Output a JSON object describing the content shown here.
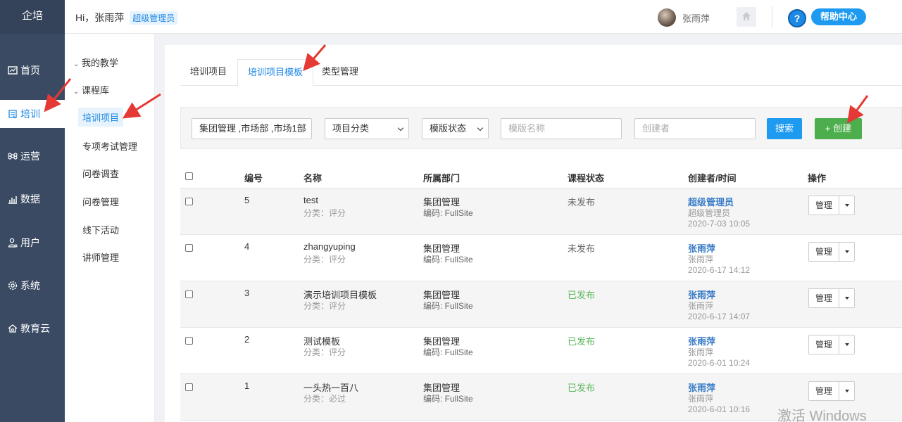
{
  "app": {
    "brand": "企培"
  },
  "leftnav": [
    {
      "label": "首页",
      "icon": "dashboard-icon",
      "active": false
    },
    {
      "label": "培训",
      "icon": "book-icon",
      "active": true
    },
    {
      "label": "运营",
      "icon": "command-icon",
      "active": false
    },
    {
      "label": "数据",
      "icon": "chart-icon",
      "active": false
    },
    {
      "label": "用户",
      "icon": "user-icon",
      "active": false
    },
    {
      "label": "系统",
      "icon": "gear-icon",
      "active": false
    },
    {
      "label": "教育云",
      "icon": "cloud-icon",
      "active": false
    }
  ],
  "header": {
    "greeting": "Hi，张雨萍",
    "role": "超级管理员",
    "username": "张雨萍",
    "help_label": "帮助中心",
    "help_q": "?"
  },
  "subnav": {
    "groups": [
      "我的教学",
      "课程库"
    ],
    "items": [
      "培训项目",
      "专项考试管理",
      "问卷调查",
      "问卷管理",
      "线下活动",
      "讲师管理"
    ]
  },
  "tabs": [
    "培训项目",
    "培训项目模板",
    "类型管理"
  ],
  "filter": {
    "dept_value": "集团管理 ,市场部 ,市场1部",
    "category_value": "项目分类",
    "status_value": "模版状态",
    "name_placeholder": "模版名称",
    "creator_placeholder": "创建者",
    "search_label": "搜索",
    "create_label": "+ 创建"
  },
  "table": {
    "headers": [
      "编号",
      "名称",
      "所属部门",
      "课程状态",
      "创建者/时间",
      "操作"
    ],
    "rows": [
      {
        "id": "5",
        "name": "test",
        "cat": "分类：评分",
        "dept": "集团管理",
        "code": "编码: FullSite",
        "status": "未发布",
        "creator": "超级管理员",
        "creator_sub": "超级管理员",
        "time": "2020-7-03 10:05",
        "action": "管理"
      },
      {
        "id": "4",
        "name": "zhangyuping",
        "cat": "分类：评分",
        "dept": "集团管理",
        "code": "编码: FullSite",
        "status": "未发布",
        "creator": "张雨萍",
        "creator_sub": "张雨萍",
        "time": "2020-6-17 14:12",
        "action": "管理"
      },
      {
        "id": "3",
        "name": "演示培训项目模板",
        "cat": "分类：评分",
        "dept": "集团管理",
        "code": "编码: FullSite",
        "status": "已发布",
        "creator": "张雨萍",
        "creator_sub": "张雨萍",
        "time": "2020-6-17 14:07",
        "action": "管理"
      },
      {
        "id": "2",
        "name": "测试模板",
        "cat": "分类：评分",
        "dept": "集团管理",
        "code": "编码: FullSite",
        "status": "已发布",
        "creator": "张雨萍",
        "creator_sub": "张雨萍",
        "time": "2020-6-01 10:24",
        "action": "管理"
      },
      {
        "id": "1",
        "name": "一头热一百八",
        "cat": "分类：必过",
        "dept": "集团管理",
        "code": "编码: FullSite",
        "status": "已发布",
        "creator": "张雨萍",
        "creator_sub": "张雨萍",
        "time": "2020-6-01 10:16",
        "action": "管理"
      }
    ]
  },
  "watermark": "激活 Windows",
  "colors": {
    "accent": "#1e88e5",
    "nav_bg": "#3a4a63",
    "create_green": "#4cae4c",
    "published_green": "#5cb85c",
    "arrow_red": "#e53935"
  }
}
